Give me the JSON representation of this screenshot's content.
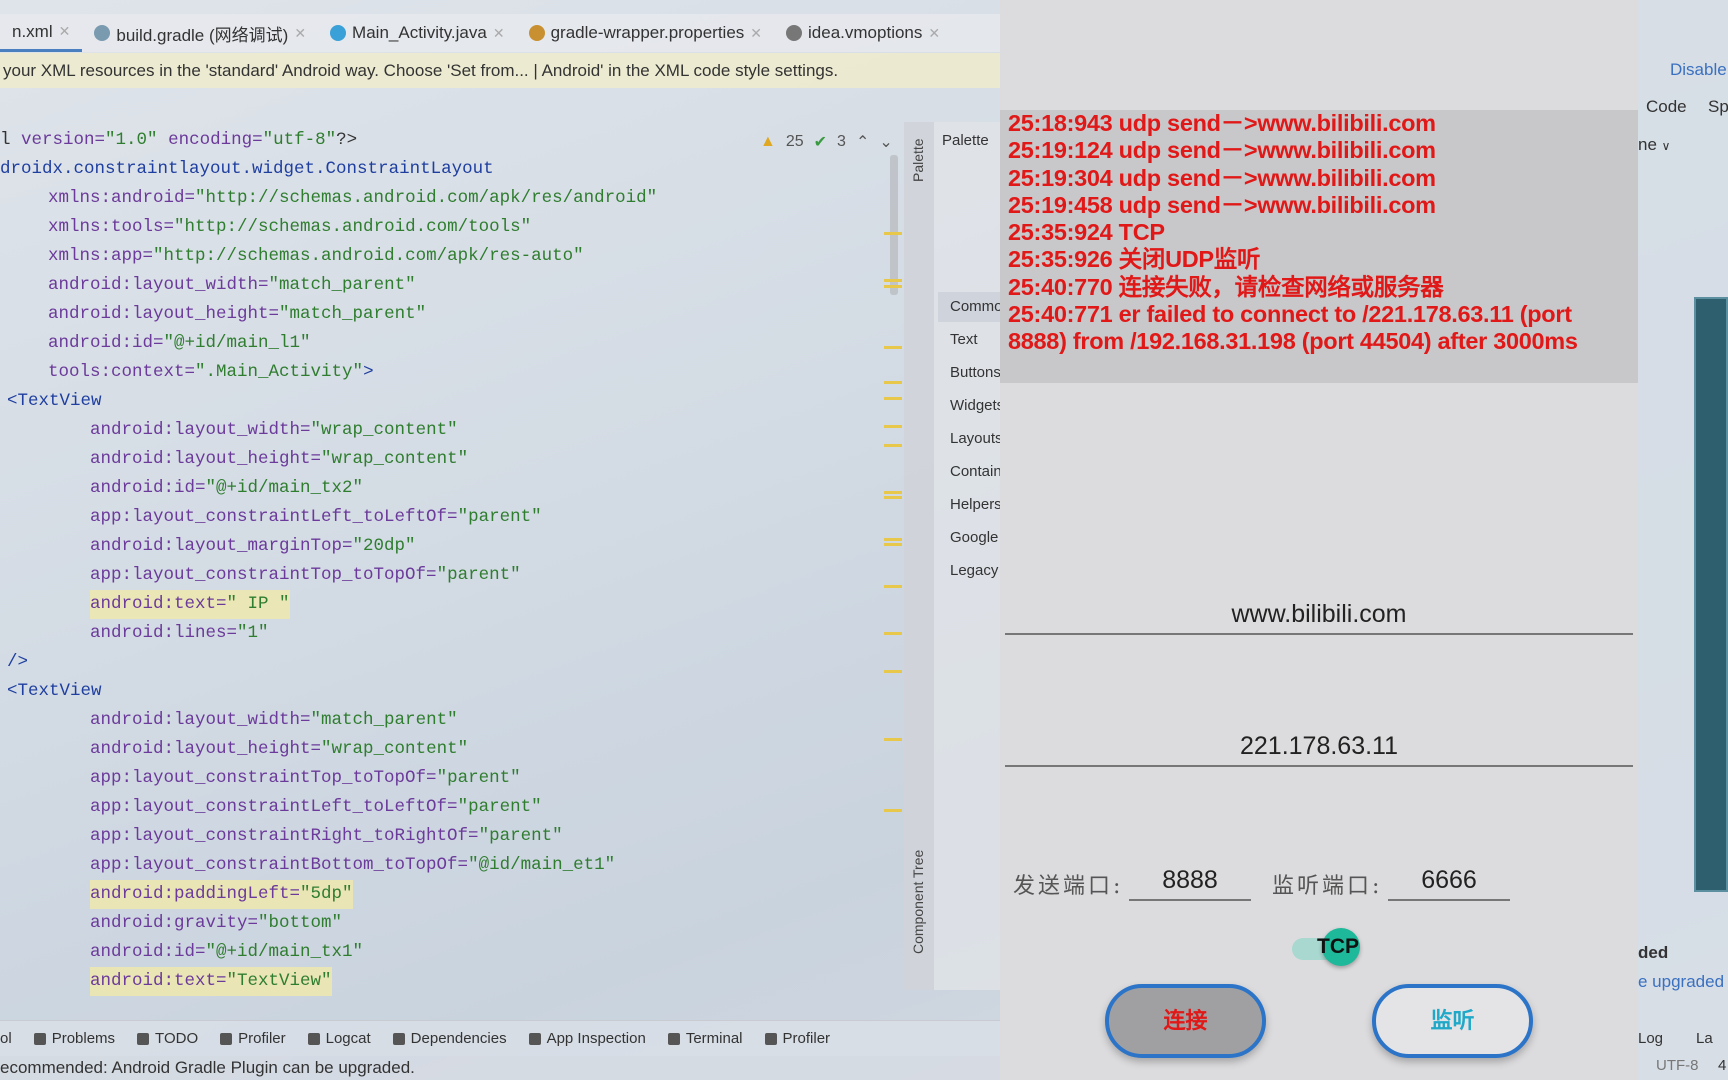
{
  "tabs": [
    {
      "label": "n.xml",
      "icon": "xml-icon",
      "active": true,
      "color": "#e07030"
    },
    {
      "label": "build.gradle (网络调试)",
      "icon": "gradle-elephant-icon",
      "color": "#7a9ab0"
    },
    {
      "label": "Main_Activity.java",
      "icon": "class-c-icon",
      "color": "#3aa0d8"
    },
    {
      "label": "gradle-wrapper.properties",
      "icon": "properties-file-icon",
      "color": "#c89030"
    },
    {
      "label": "idea.vmoptions",
      "icon": "file-icon",
      "color": "#777777"
    }
  ],
  "banner": "your XML resources in the 'standard' Android way. Choose 'Set from... | Android' in the XML code style settings.",
  "inspection": {
    "warnings": "25",
    "ok": "3"
  },
  "code": [
    {
      "lv": 0,
      "parts": [
        [
          "p",
          "l "
        ],
        [
          "a",
          "version="
        ],
        [
          "v",
          "\"1.0\""
        ],
        [
          "p",
          " "
        ],
        [
          "a",
          "encoding="
        ],
        [
          "v",
          "\"utf-8\""
        ],
        [
          "p",
          "?>"
        ]
      ]
    },
    {
      "lv": 0,
      "parts": [
        [
          "t",
          "droidx.constraintlayout.widget.ConstraintLayout"
        ]
      ]
    },
    {
      "lv": 1,
      "parts": [
        [
          "a",
          "xmlns:android="
        ],
        [
          "v",
          "\"http://schemas.android.com/apk/res/android\""
        ]
      ]
    },
    {
      "lv": 1,
      "parts": [
        [
          "a",
          "xmlns:tools="
        ],
        [
          "v",
          "\"http://schemas.android.com/tools\""
        ]
      ]
    },
    {
      "lv": 1,
      "parts": [
        [
          "a",
          "xmlns:app="
        ],
        [
          "v",
          "\"http://schemas.android.com/apk/res-auto\""
        ]
      ]
    },
    {
      "lv": 1,
      "parts": [
        [
          "a",
          "android:layout_width="
        ],
        [
          "v",
          "\"match_parent\""
        ]
      ]
    },
    {
      "lv": 1,
      "parts": [
        [
          "a",
          "android:layout_height="
        ],
        [
          "v",
          "\"match_parent\""
        ]
      ]
    },
    {
      "lv": 1,
      "parts": [
        [
          "a",
          "android:id="
        ],
        [
          "v",
          "\"@+id/main_l1\""
        ]
      ]
    },
    {
      "lv": 1,
      "parts": [
        [
          "a",
          "tools:context="
        ],
        [
          "v",
          "\".Main_Activity\""
        ],
        [
          "t",
          ">"
        ]
      ]
    },
    {
      "lv": "tag",
      "parts": [
        [
          "t",
          "<TextView"
        ]
      ]
    },
    {
      "lv": 2,
      "parts": [
        [
          "a",
          "android:layout_width="
        ],
        [
          "v",
          "\"wrap_content\""
        ]
      ]
    },
    {
      "lv": 2,
      "parts": [
        [
          "a",
          "android:layout_height="
        ],
        [
          "v",
          "\"wrap_content\""
        ]
      ]
    },
    {
      "lv": 2,
      "parts": [
        [
          "a",
          "android:id="
        ],
        [
          "v",
          "\"@+id/main_tx2\""
        ]
      ]
    },
    {
      "lv": 2,
      "parts": [
        [
          "a",
          "app:layout_constraintLeft_toLeftOf="
        ],
        [
          "v",
          "\"parent\""
        ]
      ]
    },
    {
      "lv": 2,
      "parts": [
        [
          "a",
          "android:layout_marginTop="
        ],
        [
          "v",
          "\"20dp\""
        ]
      ]
    },
    {
      "lv": 2,
      "parts": [
        [
          "a",
          "app:layout_constraintTop_toTopOf="
        ],
        [
          "v",
          "\"parent\""
        ]
      ]
    },
    {
      "lv": 2,
      "hl": true,
      "parts": [
        [
          "a",
          "android:text="
        ],
        [
          "v",
          "\" IP \""
        ]
      ]
    },
    {
      "lv": 2,
      "parts": [
        [
          "a",
          "android:lines="
        ],
        [
          "v",
          "\"1\""
        ]
      ]
    },
    {
      "lv": "tag",
      "parts": [
        [
          "t",
          "/>"
        ]
      ]
    },
    {
      "lv": "tag",
      "parts": [
        [
          "t",
          "<TextView"
        ]
      ]
    },
    {
      "lv": 2,
      "parts": [
        [
          "a",
          "android:layout_width="
        ],
        [
          "v",
          "\"match_parent\""
        ]
      ]
    },
    {
      "lv": 2,
      "parts": [
        [
          "a",
          "android:layout_height="
        ],
        [
          "v",
          "\"wrap_content\""
        ]
      ]
    },
    {
      "lv": 2,
      "parts": [
        [
          "a",
          "app:layout_constraintTop_toTopOf="
        ],
        [
          "v",
          "\"parent\""
        ]
      ]
    },
    {
      "lv": 2,
      "parts": [
        [
          "a",
          "app:layout_constraintLeft_toLeftOf="
        ],
        [
          "v",
          "\"parent\""
        ]
      ]
    },
    {
      "lv": 2,
      "parts": [
        [
          "a",
          "app:layout_constraintRight_toRightOf="
        ],
        [
          "v",
          "\"parent\""
        ]
      ]
    },
    {
      "lv": 2,
      "parts": [
        [
          "a",
          "app:layout_constraintBottom_toTopOf="
        ],
        [
          "v",
          "\"@id/main_et1\""
        ]
      ]
    },
    {
      "lv": 2,
      "hl": true,
      "parts": [
        [
          "a",
          "android:paddingLeft="
        ],
        [
          "v",
          "\"5dp\""
        ]
      ]
    },
    {
      "lv": 2,
      "parts": [
        [
          "a",
          "android:gravity="
        ],
        [
          "v",
          "\"bottom\""
        ]
      ]
    },
    {
      "lv": 2,
      "parts": [
        [
          "a",
          "android:id="
        ],
        [
          "v",
          "\"@+id/main_tx1\""
        ]
      ]
    },
    {
      "lv": 2,
      "hl": true,
      "parts": [
        [
          "a",
          "android:text="
        ],
        [
          "v",
          "\"TextView\""
        ]
      ]
    }
  ],
  "palette": {
    "title": "Palette",
    "items": [
      "Common",
      "Text",
      "Buttons",
      "Widgets",
      "Layouts",
      "Containers",
      "Helpers",
      "Google",
      "Legacy"
    ],
    "selected": "Common",
    "side_label": "Palette",
    "component_tree": "Component Tree"
  },
  "phone": {
    "log": [
      "25:18:943 udp send－>www.bilibili.com",
      "25:19:124 udp send－>www.bilibili.com",
      "25:19:304 udp send－>www.bilibili.com",
      "25:19:458 udp send－>www.bilibili.com",
      "25:35:924 TCP",
      "25:35:926 关闭UDP监听",
      "25:40:770 连接失败，请检查网络或服务器",
      "25:40:771 er  failed to connect to /221.178.63.11 (port",
      "8888) from /192.168.31.198 (port 44504) after 3000ms"
    ],
    "log_color": "#e01818",
    "message_field": "www.bilibili.com",
    "ip_field": "221.178.63.11",
    "send_port_label": "发送端口:",
    "send_port": "8888",
    "listen_port_label": "监听端口:",
    "listen_port": "6666",
    "switch_label": "TCP",
    "switch_on": true,
    "connect_button": "连接",
    "listen_button": "监听",
    "accent": "#2b74c8"
  },
  "right": {
    "disable": "Disable",
    "code": "Code",
    "split": "Sp",
    "combo": "ne",
    "notif_title": "ded",
    "notif_link": "e upgraded",
    "log": "Log",
    "layout": "La",
    "encoding": "UTF-8",
    "indent": "4"
  },
  "toolwindows": [
    {
      "label": "ol",
      "icon": "tool-icon"
    },
    {
      "label": "Problems",
      "icon": "problems-icon"
    },
    {
      "label": "TODO",
      "icon": "todo-list-icon"
    },
    {
      "label": "Profiler",
      "icon": "profiler-icon"
    },
    {
      "label": "Logcat",
      "icon": "logcat-icon"
    },
    {
      "label": "Dependencies",
      "icon": "dependencies-icon"
    },
    {
      "label": "App Inspection",
      "icon": "app-inspection-icon"
    },
    {
      "label": "Terminal",
      "icon": "terminal-icon"
    },
    {
      "label": "Profiler",
      "icon": "profiler-gauge-icon"
    }
  ],
  "status": "ecommended: Android Gradle Plugin can be upgraded."
}
